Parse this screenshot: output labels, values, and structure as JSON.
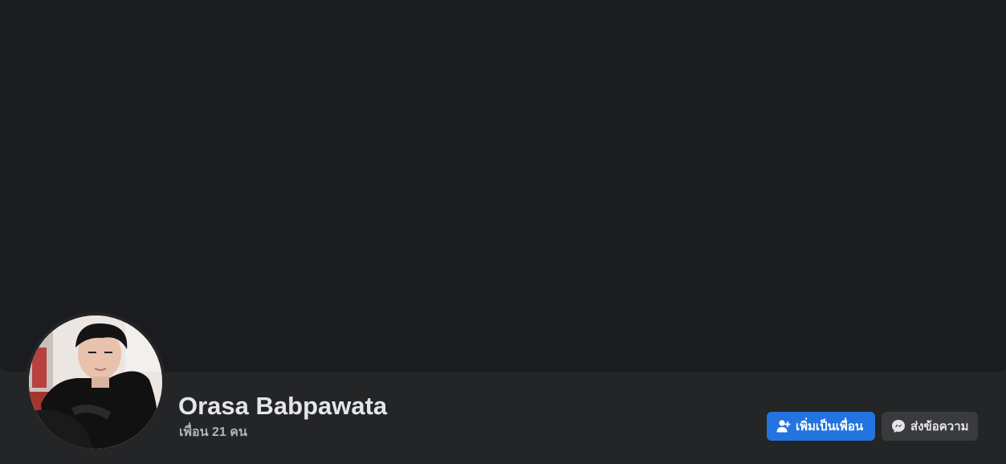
{
  "profile": {
    "name": "Orasa Babpawata",
    "friends_count": "เพื่อน 21 คน"
  },
  "actions": {
    "add_friend_label": "เพิ่มเป็นเพื่อน",
    "message_label": "ส่งข้อความ"
  },
  "icons": {
    "add_friend": "person-plus-icon",
    "message": "messenger-icon"
  },
  "colors": {
    "page_background": "#242526",
    "cover_background": "#1b1c1f",
    "primary_button": "#2374e1",
    "secondary_button": "#3a3b3c",
    "primary_text": "#e4e6eb",
    "secondary_text": "#b0b3b8"
  }
}
